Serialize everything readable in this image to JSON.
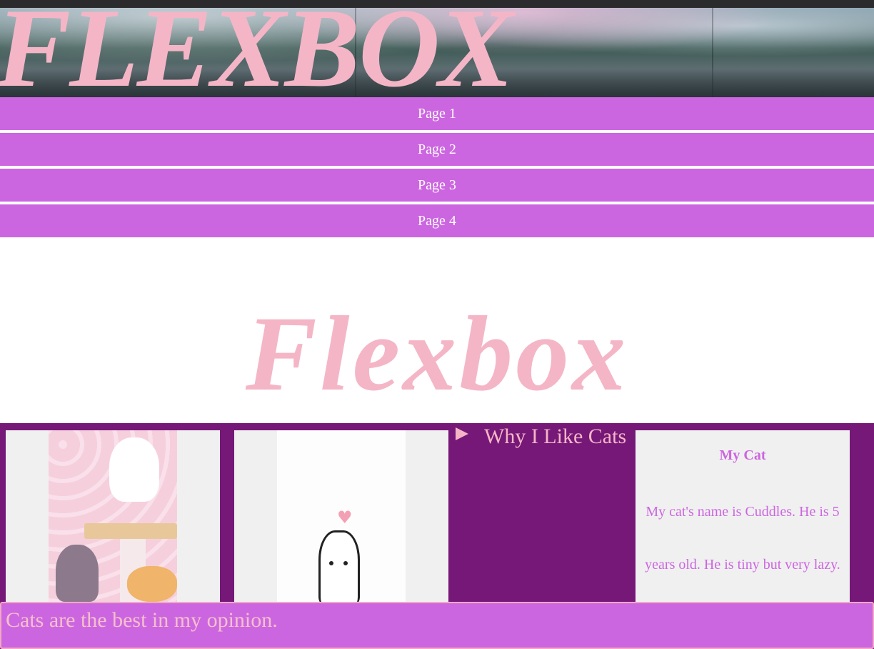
{
  "header": {
    "title": "FLEXBOX"
  },
  "nav": {
    "items": [
      "Page 1",
      "Page 2",
      "Page 3",
      "Page 4"
    ]
  },
  "hero": {
    "title": "Flexbox"
  },
  "content": {
    "details_summary": "Why I Like Cats",
    "my_cat": {
      "heading": "My Cat",
      "text": "My cat's name is Cuddles. He is 5 years old. He is tiny but very lazy. I"
    }
  },
  "footer": {
    "text": "Cats are the best in my opinion."
  },
  "colors": {
    "nav": "#cc66e0",
    "pink_text": "#f4b6c6",
    "content_bg": "#761878",
    "card_bg": "#f0f0f0"
  }
}
